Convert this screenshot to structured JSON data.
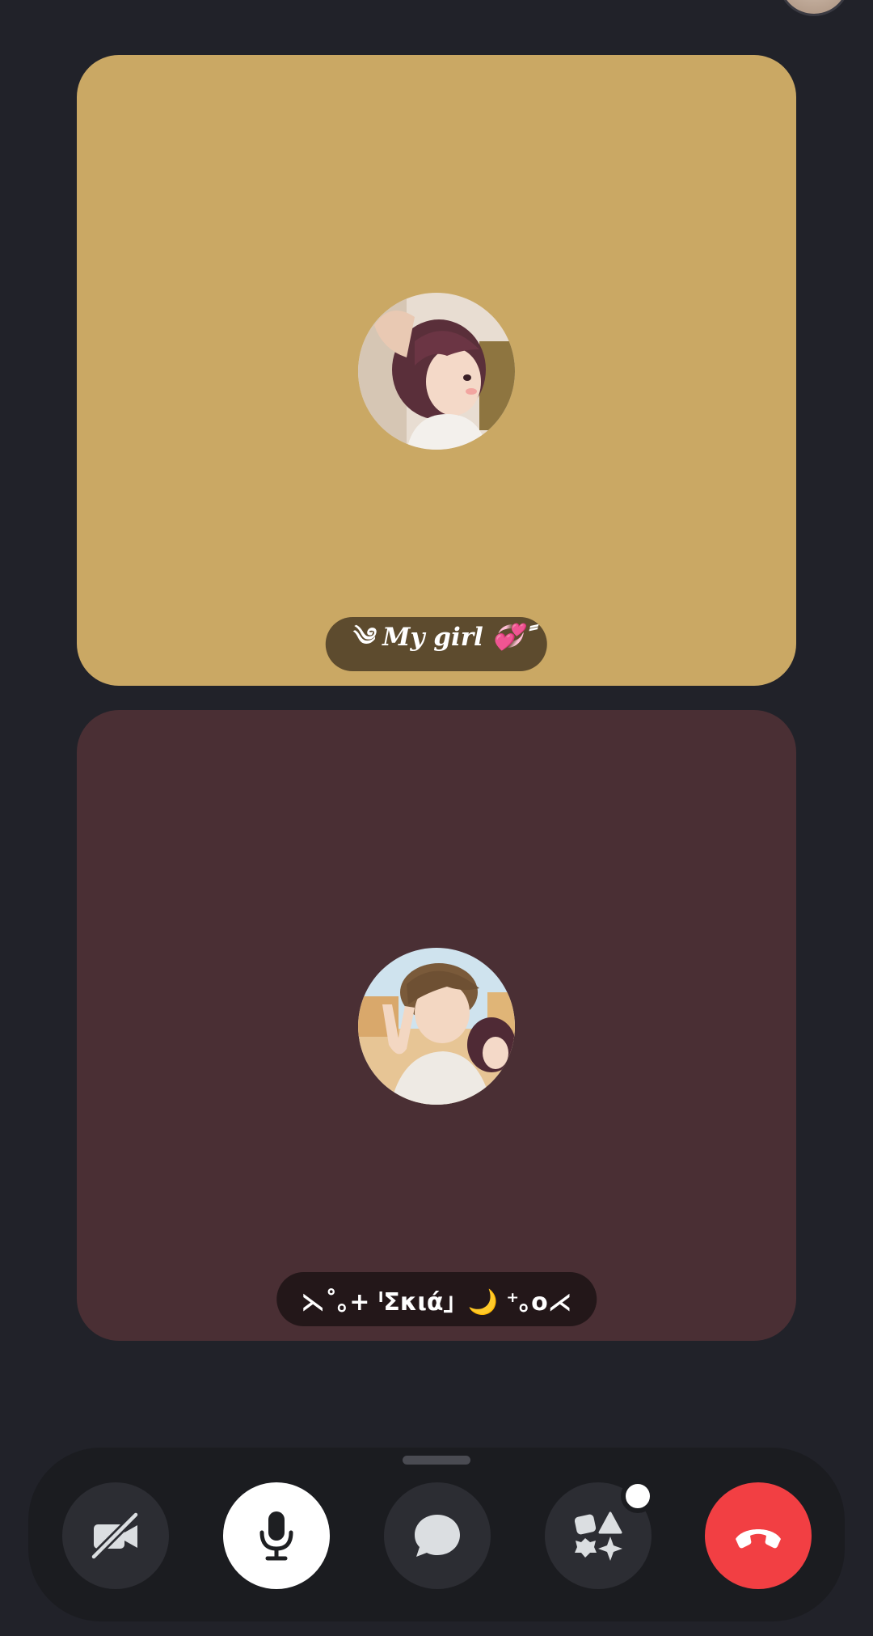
{
  "call": {
    "participants": [
      {
        "display_name": "༄ 𝑴𝒚 𝒈𝒊𝒓𝒍 💞ً",
        "tile_color": "#caa864",
        "avatar": "anime-girl-avatar"
      },
      {
        "display_name": "⋋˚｡+ ˡΣκιά」🌙 ⁺｡o⋌",
        "tile_color": "#4a2f34",
        "avatar": "anime-boy-peace-sign-avatar"
      }
    ]
  },
  "controls": {
    "camera": {
      "icon": "camera-off-icon",
      "state": "off"
    },
    "microphone": {
      "icon": "microphone-icon",
      "state": "on"
    },
    "chat": {
      "icon": "chat-bubble-icon"
    },
    "activities": {
      "icon": "activities-shapes-icon",
      "has_notification": true
    },
    "end_call": {
      "icon": "hang-up-icon",
      "color": "#f23f43"
    }
  },
  "colors": {
    "background": "#212229",
    "control_bar": "#1b1c20",
    "button": "#2c2d33",
    "accent_red": "#f23f43"
  }
}
